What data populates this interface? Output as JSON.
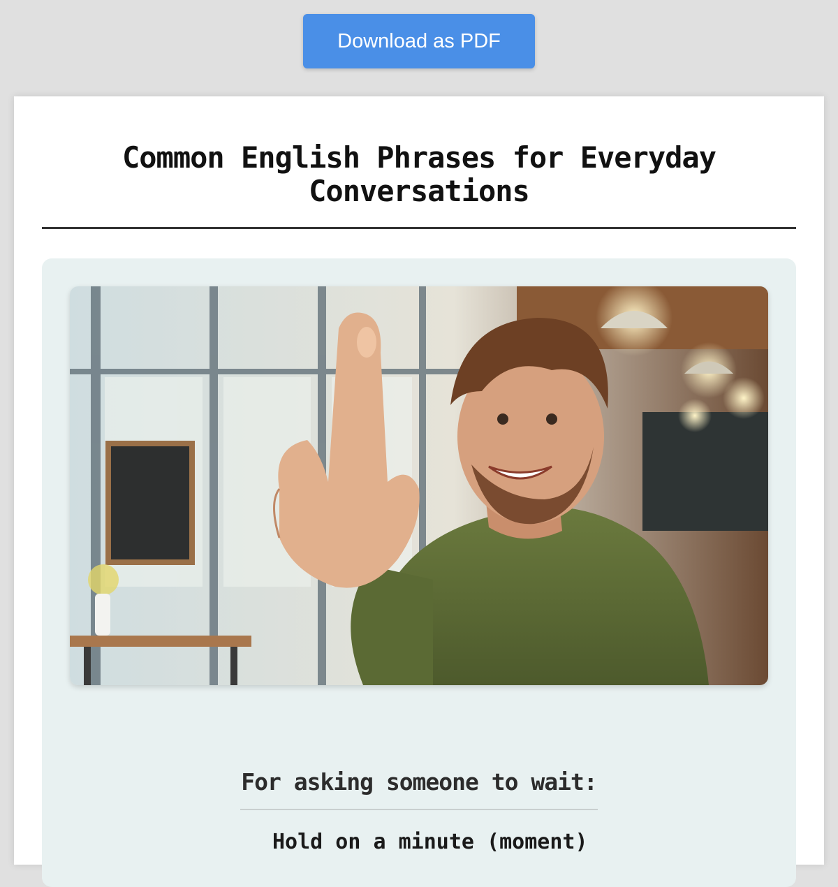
{
  "toolbar": {
    "download_label": "Download as PDF",
    "accent_color": "#4a8fe7"
  },
  "document": {
    "title": "Common English Phrases for Everyday Conversations",
    "section": {
      "heading": "For asking someone to wait:",
      "first_phrase": "Hold on a minute (moment)"
    }
  },
  "photo": {
    "icon": "man-raising-index-finger-photo",
    "background_color": "#e8f1f1"
  }
}
